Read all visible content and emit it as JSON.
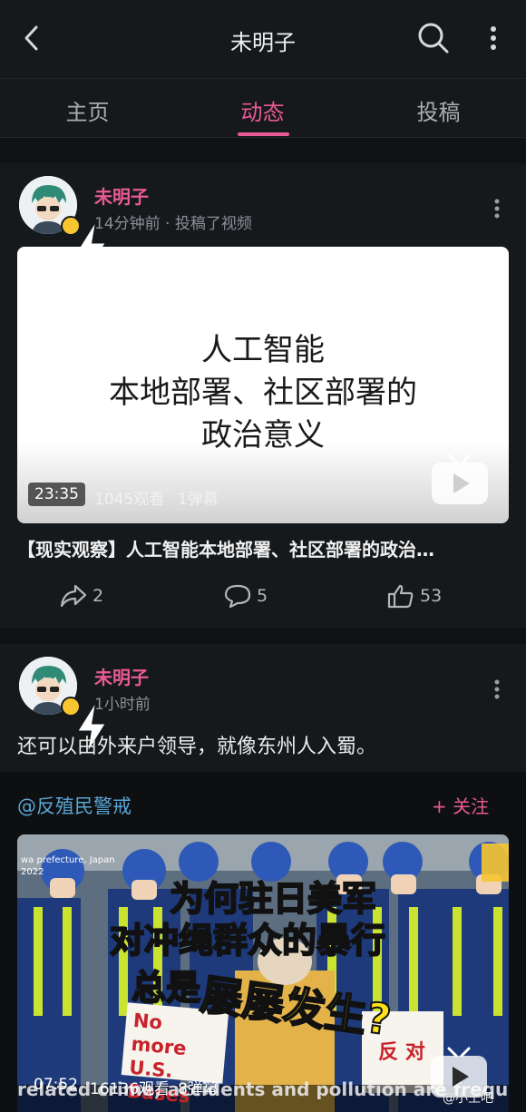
{
  "header": {
    "title": "未明子"
  },
  "tabs": [
    {
      "label": "主页"
    },
    {
      "label": "动态"
    },
    {
      "label": "投稿"
    }
  ],
  "posts": [
    {
      "author": "未明子",
      "meta": "14分钟前 · 投稿了视频",
      "video": {
        "lines": [
          "人工智能",
          "本地部署、社区部署的",
          "政治意义"
        ],
        "duration": "23:35",
        "views": "1045观看",
        "danmaku": "1弹幕",
        "title": "【现实观察】人工智能本地部署、社区部署的政治…"
      },
      "actions": {
        "share": "2",
        "comment": "5",
        "like": "53"
      }
    },
    {
      "author": "未明子",
      "meta": "1小时前",
      "text": "还可以由外来户领导，就像东州人入蜀。",
      "repost": {
        "user": "@反殖民警戒",
        "follow": "+ 关注",
        "video": {
          "caption_lines": [
            "为何驻日美军",
            "对冲绳群众的暴行",
            "总是"
          ],
          "caption_highlight": "屡屡发生?",
          "sign_text": "No more U.S. Bases",
          "sign2_text": "反 对",
          "corner_text": "wa prefecture, Japan 2022",
          "bottom_text": "related crime, accidents and pollution are frequent irritants",
          "duration": "07:52",
          "views": "16136观看",
          "danmaku": "8弹幕"
        }
      }
    }
  ],
  "watermark": "@小王吧",
  "colors": {
    "accent": "#e85b92",
    "link": "#5aa6d6",
    "bg": "#0f1113",
    "card": "#16191c"
  }
}
